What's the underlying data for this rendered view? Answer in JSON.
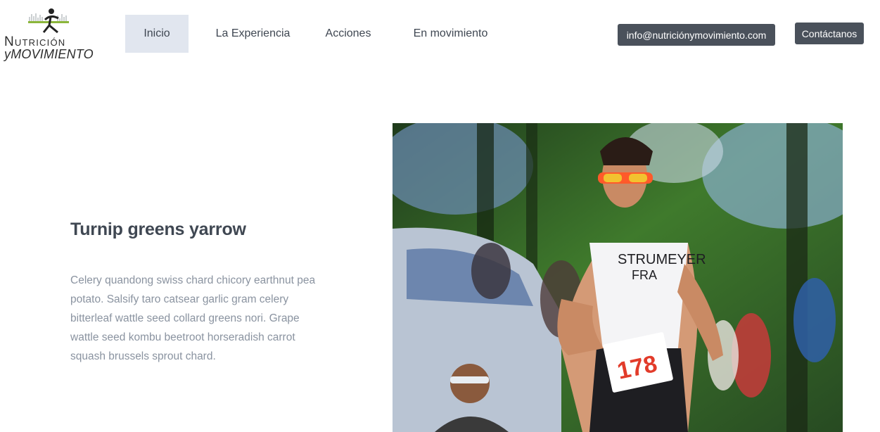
{
  "brand": {
    "name_line1": "Nutrición",
    "name_line2": "yMOVIMIENTO",
    "logo_icon": "runner-logo-icon"
  },
  "nav": {
    "items": [
      {
        "label": "Inicio",
        "active": true
      },
      {
        "label": "La Experiencia",
        "active": false
      },
      {
        "label": "Acciones",
        "active": false
      },
      {
        "label": "En movimiento",
        "active": false
      }
    ]
  },
  "header_actions": {
    "email_label": "info@nutriciónymovimiento.com",
    "contact_label": "Contáctanos"
  },
  "hero": {
    "title": "Turnip greens yarrow",
    "body": "Celery quandong swiss chard chicory earthnut pea potato. Salsify taro catsear garlic gram celery bitterleaf wattle seed collard greens nori. Grape wattle seed kombu beetroot horseradish carrot squash brussels sprout chard.",
    "image": {
      "bib_number": "178",
      "jersey_name": "STRUMEYER",
      "jersey_country": "FRA"
    }
  },
  "colors": {
    "nav_active_bg": "#e1e6ef",
    "button_bg": "#4a515b",
    "heading": "#3f4752",
    "body_text": "#8a93a0"
  }
}
